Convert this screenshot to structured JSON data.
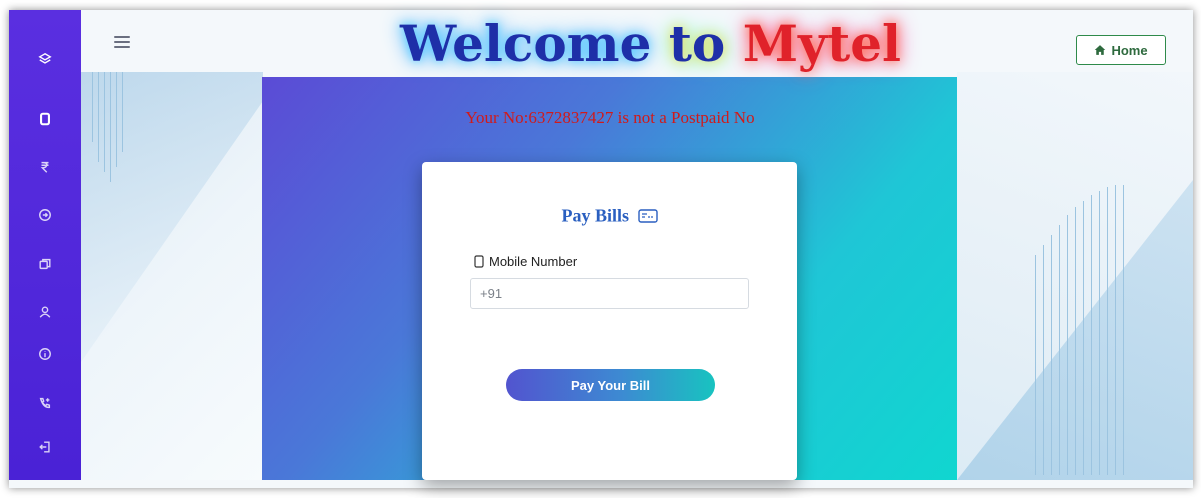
{
  "header": {
    "welcome_part1": "Welcome",
    "welcome_part2": "to",
    "welcome_part3": "Mytel",
    "home_label": "Home"
  },
  "sidebar": {
    "items": [
      {
        "icon": "layers-icon"
      },
      {
        "icon": "phone-icon"
      },
      {
        "icon": "rupee-icon"
      },
      {
        "icon": "circle-arrow-icon"
      },
      {
        "icon": "copy-icon"
      },
      {
        "icon": "user-icon"
      },
      {
        "icon": "info-icon"
      },
      {
        "icon": "phone-plus-icon"
      },
      {
        "icon": "logout-icon"
      }
    ]
  },
  "main": {
    "error_message": "Your No:6372837427 is not a Postpaid No",
    "card": {
      "title": "Pay Bills",
      "mobile_label": "Mobile Number",
      "mobile_placeholder": "+91",
      "submit_label": "Pay Your Bill"
    }
  },
  "colors": {
    "sidebar": "#4a22d6",
    "error": "#d11a1a",
    "title": "#2a5fc0",
    "home_border": "#2e8a4a"
  }
}
